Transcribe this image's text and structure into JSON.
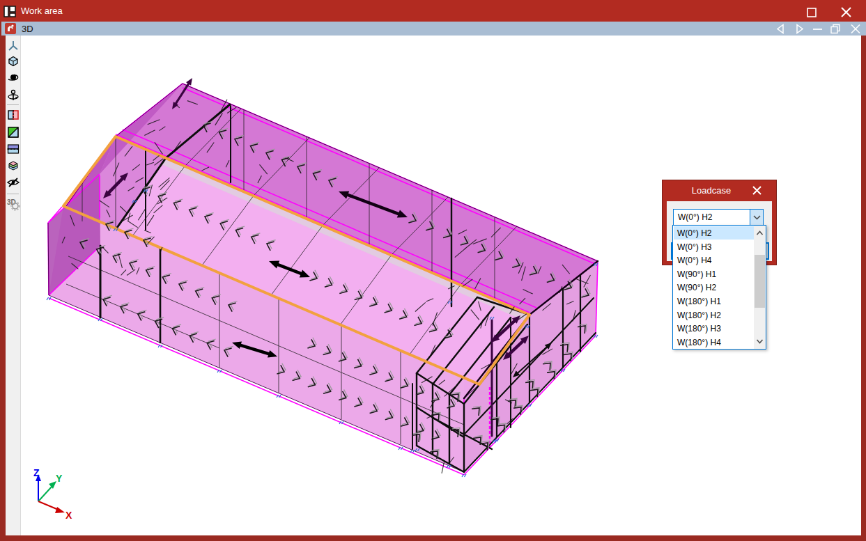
{
  "window": {
    "title": "Work area",
    "maximize_icon": "maximize-square",
    "close_icon": "close-x"
  },
  "tabbar": {
    "tab_label": "3D",
    "tab_icon": "3d-view-icon",
    "controls": [
      "previous-view",
      "next-view",
      "minimize",
      "restore",
      "close"
    ]
  },
  "toolbar": {
    "items": [
      {
        "name": "coordinate-axes"
      },
      {
        "name": "isometric-cube"
      },
      {
        "name": "rotate-view"
      },
      {
        "name": "orbit"
      },
      {
        "name": "clipping-plane"
      },
      {
        "name": "render-mode"
      },
      {
        "name": "section-box"
      },
      {
        "name": "layers"
      },
      {
        "name": "hide-objects"
      },
      {
        "name": "3d-settings",
        "label": "3D"
      }
    ]
  },
  "dialog": {
    "title": "Loadcase",
    "combobox": {
      "value": "W(0°) H2"
    },
    "dropdown": {
      "items": [
        "W(0°) H2",
        "W(0°) H3",
        "W(0°) H4",
        "W(90°) H1",
        "W(90°) H2",
        "W(180°) H1",
        "W(180°) H2",
        "W(180°) H3",
        "W(180°) H4"
      ],
      "selected_index": 0
    }
  },
  "axes": {
    "x_label": "X",
    "y_label": "Y",
    "z_label": "Z"
  },
  "colors": {
    "titlebar_red": "#B22B21",
    "tabbar_blue": "#A9BDD3",
    "selection_blue": "#0078D7",
    "highlight_orange": "#F2A13F",
    "surface_magenta": "#EFA9EC",
    "edge_magenta": "#FF00FF",
    "axis_x_red": "#CC0000",
    "axis_y_green": "#00B050",
    "axis_z_blue": "#0000EE"
  }
}
